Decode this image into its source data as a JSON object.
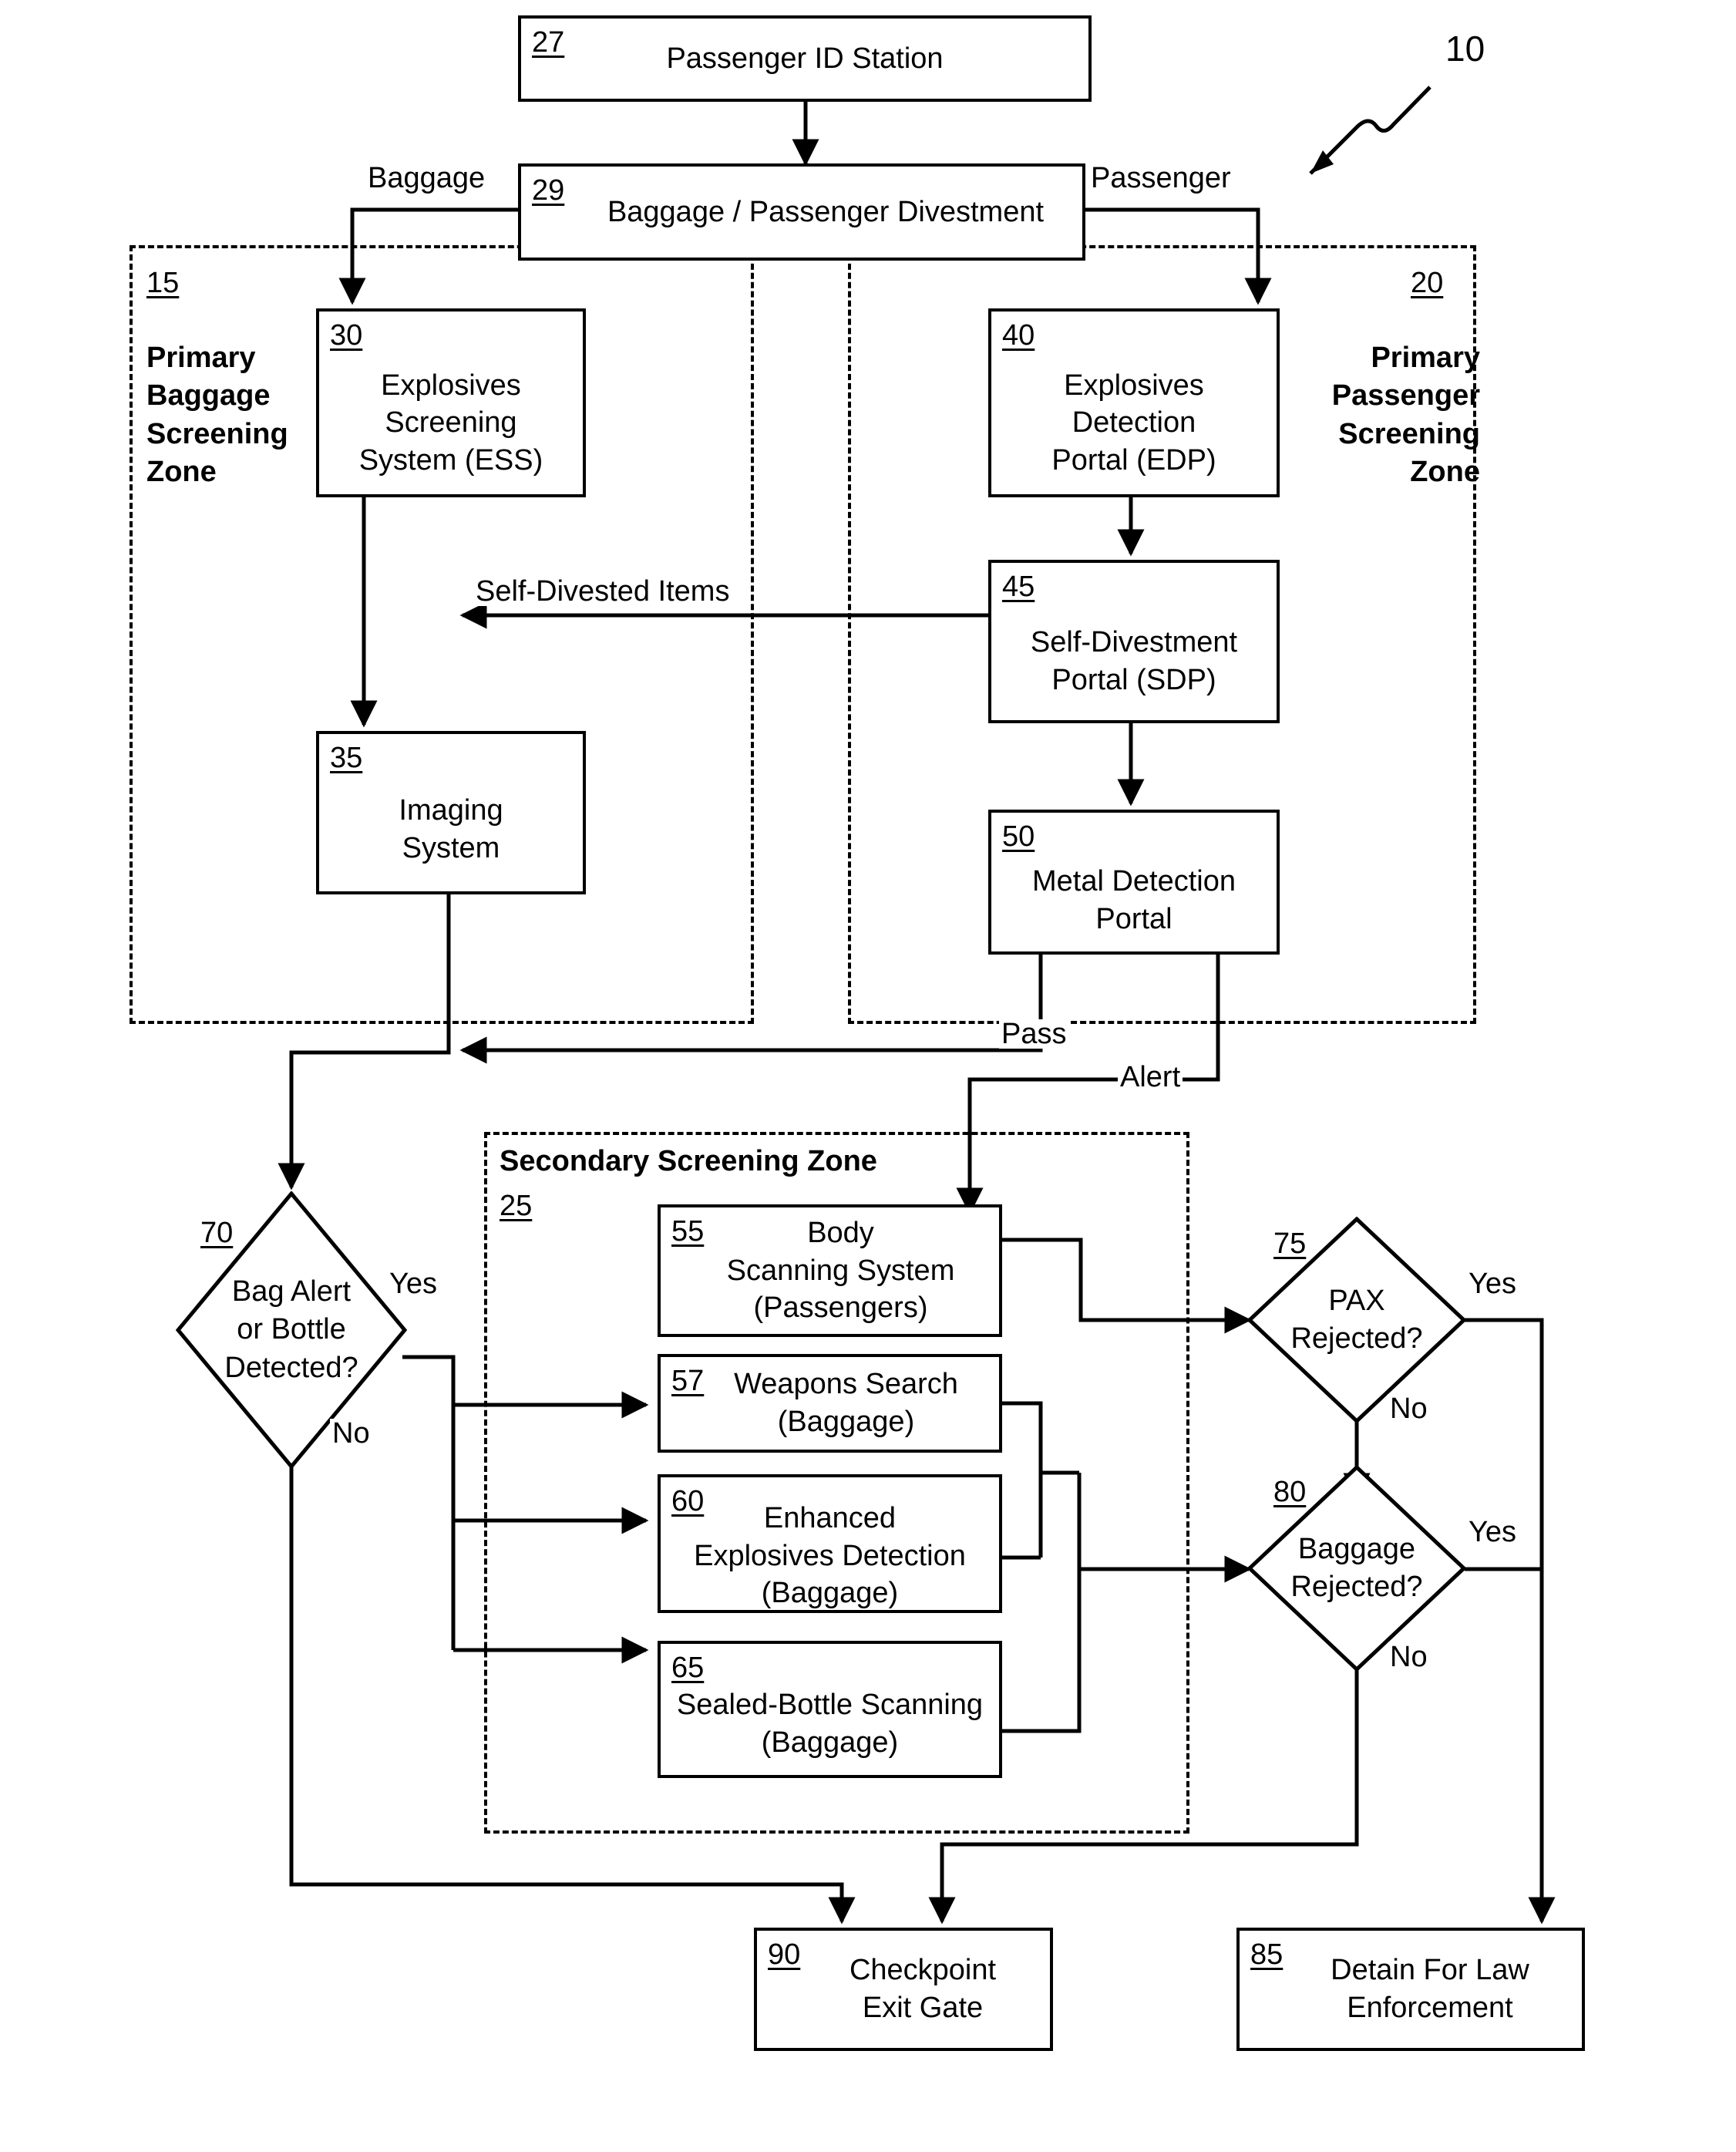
{
  "figure": {
    "id_label": "10"
  },
  "zones": [
    {
      "key": "primary_baggage",
      "ref": "15",
      "title": "Primary\nBaggage\nScreening\nZone"
    },
    {
      "key": "primary_passenger",
      "ref": "20",
      "title": "Primary\nPassenger\nScreening\nZone"
    },
    {
      "key": "secondary",
      "ref": "25",
      "title": "Secondary Screening Zone"
    }
  ],
  "nodes": {
    "passenger_id_station": {
      "ref": "27",
      "label": "Passenger ID Station"
    },
    "divestment": {
      "ref": "29",
      "label": "Baggage / Passenger Divestment"
    },
    "ess": {
      "ref": "30",
      "label": "Explosives\nScreening\nSystem (ESS)"
    },
    "imaging": {
      "ref": "35",
      "label": "Imaging\nSystem"
    },
    "edp": {
      "ref": "40",
      "label": "Explosives\nDetection\nPortal (EDP)"
    },
    "sdp": {
      "ref": "45",
      "label": "Self-Divestment\nPortal (SDP)"
    },
    "metal_detection": {
      "ref": "50",
      "label": "Metal Detection\nPortal"
    },
    "body_scanning": {
      "ref": "55",
      "label": "Body\nScanning System\n(Passengers)"
    },
    "weapons_search": {
      "ref": "57",
      "label": "Weapons Search\n(Baggage)"
    },
    "enhanced_explosives": {
      "ref": "60",
      "label": "Enhanced\nExplosives Detection\n(Baggage)"
    },
    "sealed_bottle": {
      "ref": "65",
      "label": "Sealed-Bottle Scanning\n(Baggage)"
    },
    "bag_alert_decision": {
      "ref": "70",
      "label": "Bag Alert\nor Bottle\nDetected?"
    },
    "pax_rejected_decision": {
      "ref": "75",
      "label": "PAX\nRejected?"
    },
    "baggage_rejected_decision": {
      "ref": "80",
      "label": "Baggage\nRejected?"
    },
    "detain": {
      "ref": "85",
      "label": "Detain For Law\nEnforcement"
    },
    "exit_gate": {
      "ref": "90",
      "label": "Checkpoint\nExit Gate"
    }
  },
  "edge_labels": {
    "baggage": "Baggage",
    "passenger": "Passenger",
    "self_divested_items": "Self-Divested Items",
    "pass": "Pass",
    "alert": "Alert",
    "bag_decision_yes": "Yes",
    "bag_decision_no": "No",
    "pax_yes": "Yes",
    "pax_no": "No",
    "baggage_yes": "Yes",
    "baggage_no": "No"
  }
}
